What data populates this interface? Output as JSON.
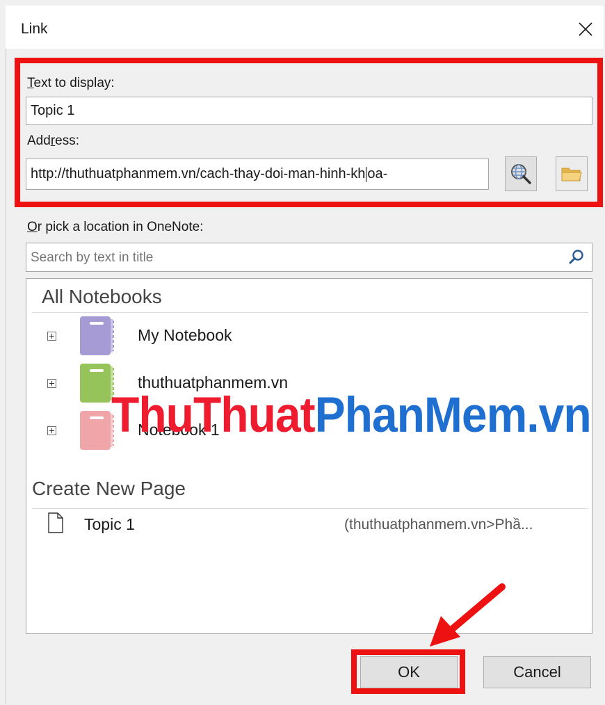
{
  "dialog": {
    "title": "Link",
    "close_icon": "close-icon"
  },
  "text_to_display": {
    "label_key": "T",
    "label_rest": "ext to display:",
    "value": "Topic 1"
  },
  "address": {
    "label_before": "Add",
    "label_key": "r",
    "label_after": "ess:",
    "value_before_caret": "http://thuthuatphanmem.vn/cach-thay-doi-man-hinh-kh",
    "value_after_caret": "oa-",
    "browse_web_icon": "globe-search-icon",
    "browse_file_icon": "folder-icon"
  },
  "pick_location": {
    "label_key": "O",
    "label_rest": "r pick a location in OneNote:",
    "search_placeholder": "Search by text in title",
    "search_icon": "magnifier-icon"
  },
  "notebooks": {
    "heading": "All Notebooks",
    "items": [
      {
        "label": "My Notebook",
        "color": "#a79bd6"
      },
      {
        "label": "thuthuatphanmem.vn",
        "color": "#97c45a"
      },
      {
        "label": "Notebook 1",
        "color": "#f0a6a9"
      }
    ]
  },
  "create_new": {
    "heading": "Create New Page",
    "page_label": "Topic 1",
    "page_path": "(thuthuatphanmem.vn>Phầ..."
  },
  "watermark": {
    "part1": "ThuThuat",
    "part2": "PhanMem.vn"
  },
  "buttons": {
    "ok": "OK",
    "cancel": "Cancel"
  },
  "colors": {
    "highlight": "#ee1111",
    "watermark_red": "#ee1c2e",
    "watermark_blue": "#1f6fd1"
  }
}
